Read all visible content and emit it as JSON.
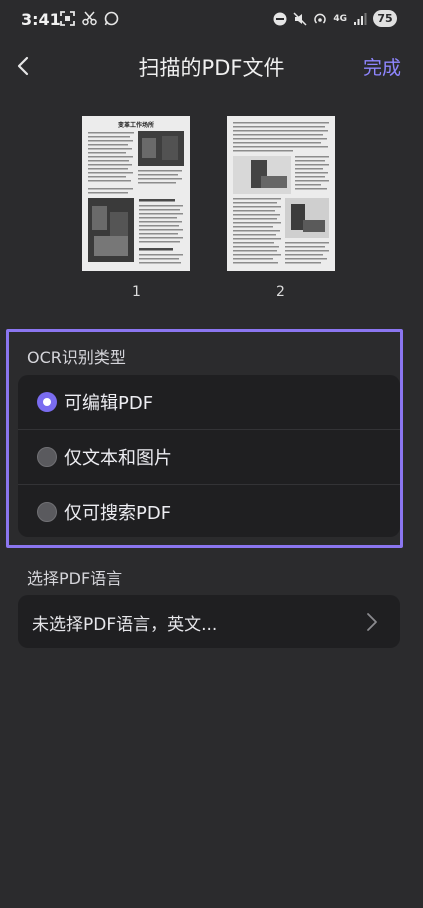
{
  "status": {
    "time": "3:41",
    "network": "4G",
    "battery": "75",
    "icons": [
      "screenshot-icon",
      "scissors-icon",
      "whatsapp-icon",
      "dnd-icon",
      "mute-icon",
      "hotspot-icon",
      "signal-icon"
    ]
  },
  "header": {
    "title": "扫描的PDF文件",
    "done_label": "完成"
  },
  "pages": [
    {
      "number": "1",
      "heading": "变革工作场所"
    },
    {
      "number": "2"
    }
  ],
  "ocr": {
    "label": "OCR识别类型",
    "selected_index": 0,
    "options": [
      {
        "label": "可编辑PDF",
        "selected": true
      },
      {
        "label": "仅文本和图片",
        "selected": false
      },
      {
        "label": "仅可搜索PDF",
        "selected": false
      }
    ]
  },
  "language": {
    "label": "选择PDF语言",
    "value": "未选择PDF语言，英文..."
  },
  "colors": {
    "background": "#2b2b2d",
    "card": "#1f1f21",
    "accent": "#8f86ff",
    "highlight_border": "#8b76f0"
  }
}
